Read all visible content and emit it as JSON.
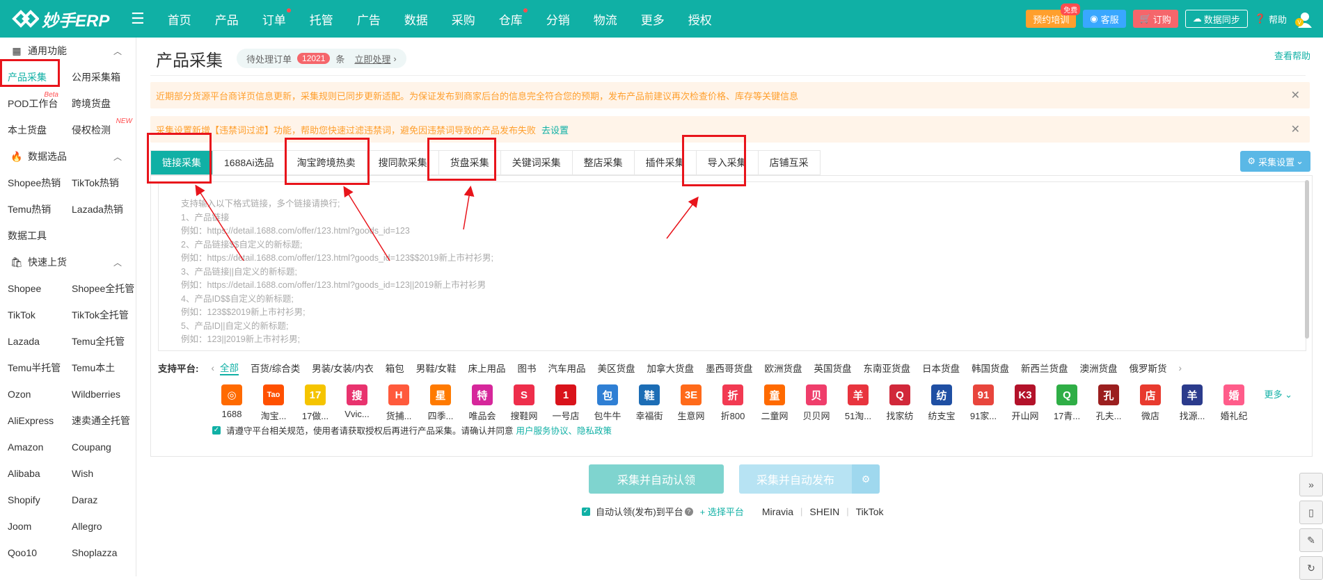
{
  "header": {
    "logo": "妙手ERP",
    "nav": [
      {
        "label": "首页",
        "dot": false
      },
      {
        "label": "产品",
        "dot": false
      },
      {
        "label": "订单",
        "dot": true
      },
      {
        "label": "托管",
        "dot": false
      },
      {
        "label": "广告",
        "dot": false
      },
      {
        "label": "数据",
        "dot": false
      },
      {
        "label": "采购",
        "dot": false
      },
      {
        "label": "仓库",
        "dot": true
      },
      {
        "label": "分销",
        "dot": false
      },
      {
        "label": "物流",
        "dot": false
      },
      {
        "label": "更多",
        "dot": false
      },
      {
        "label": "授权",
        "dot": false
      }
    ],
    "training": "预约培训",
    "free_badge": "免费",
    "service": "客服",
    "order": "订购",
    "sync": "数据同步",
    "help": "帮助"
  },
  "sidebar": {
    "sections": [
      {
        "title": "通用功能",
        "items": [
          {
            "label": "产品采集",
            "active": true,
            "sup": ""
          },
          {
            "label": "公用采集箱",
            "active": false,
            "sup": ""
          },
          {
            "label": "POD工作台",
            "active": false,
            "sup": "Beta"
          },
          {
            "label": "跨境货盘",
            "active": false,
            "sup": ""
          },
          {
            "label": "本土货盘",
            "active": false,
            "sup": ""
          },
          {
            "label": "侵权检测",
            "active": false,
            "sup": "NEW"
          }
        ]
      },
      {
        "title": "数据选品",
        "items": [
          {
            "label": "Shopee热销",
            "active": false,
            "sup": ""
          },
          {
            "label": "TikTok热销",
            "active": false,
            "sup": ""
          },
          {
            "label": "Temu热销",
            "active": false,
            "sup": ""
          },
          {
            "label": "Lazada热销",
            "active": false,
            "sup": ""
          },
          {
            "label": "数据工具",
            "active": false,
            "sup": ""
          }
        ]
      },
      {
        "title": "快速上货",
        "items": [
          {
            "label": "Shopee",
            "active": false,
            "sup": ""
          },
          {
            "label": "Shopee全托管",
            "active": false,
            "sup": ""
          },
          {
            "label": "TikTok",
            "active": false,
            "sup": ""
          },
          {
            "label": "TikTok全托管",
            "active": false,
            "sup": ""
          },
          {
            "label": "Lazada",
            "active": false,
            "sup": ""
          },
          {
            "label": "Temu全托管",
            "active": false,
            "sup": ""
          },
          {
            "label": "Temu半托管",
            "active": false,
            "sup": ""
          },
          {
            "label": "Temu本土",
            "active": false,
            "sup": ""
          },
          {
            "label": "Ozon",
            "active": false,
            "sup": ""
          },
          {
            "label": "Wildberries",
            "active": false,
            "sup": ""
          },
          {
            "label": "AliExpress",
            "active": false,
            "sup": ""
          },
          {
            "label": "速卖通全托管",
            "active": false,
            "sup": ""
          },
          {
            "label": "Amazon",
            "active": false,
            "sup": ""
          },
          {
            "label": "Coupang",
            "active": false,
            "sup": ""
          },
          {
            "label": "Alibaba",
            "active": false,
            "sup": ""
          },
          {
            "label": "Wish",
            "active": false,
            "sup": ""
          },
          {
            "label": "Shopify",
            "active": false,
            "sup": ""
          },
          {
            "label": "Daraz",
            "active": false,
            "sup": ""
          },
          {
            "label": "Joom",
            "active": false,
            "sup": ""
          },
          {
            "label": "Allegro",
            "active": false,
            "sup": ""
          },
          {
            "label": "Qoo10",
            "active": false,
            "sup": ""
          },
          {
            "label": "Shoplazza",
            "active": false,
            "sup": ""
          }
        ]
      }
    ]
  },
  "main": {
    "title": "产品采集",
    "pending_label": "待处理订单",
    "pending_count": "12021",
    "pending_unit": "条",
    "pending_link": "立即处理",
    "help_link": "查看帮助",
    "notice1": "近期部分货源平台商详页信息更新，采集规则已同步更新适配。为保证发布到商家后台的信息完全符合您的预期，发布产品前建议再次检查价格、库存等关键信息",
    "notice2": "采集设置新增【违禁词过滤】功能，帮助您快速过滤违禁词，避免因违禁词导致的产品发布失败",
    "notice2_link": "去设置",
    "tabs": [
      "链接采集",
      "1688Ai选品",
      "淘宝跨境热卖",
      "搜同款采集",
      "货盘采集",
      "关键词采集",
      "整店采集",
      "插件采集",
      "导入采集",
      "店铺互采"
    ],
    "settings_btn": "采集设置",
    "textarea_lines": [
      "支持输入以下格式链接，多个链接请换行;",
      "1、产品链接",
      "例如：https://detail.1688.com/offer/123.html?goods_id=123",
      "2、产品链接$$自定义的新标题;",
      "例如：https://detail.1688.com/offer/123.html?goods_id=123$$2019新上市衬衫男;",
      "3、产品链接||自定义的新标题;",
      "例如：https://detail.1688.com/offer/123.html?goods_id=123||2019新上市衬衫男",
      "4、产品ID$$自定义的新标题;",
      "例如：123$$2019新上市衬衫男;",
      "5、产品ID||自定义的新标题;",
      "例如：123||2019新上市衬衫男;"
    ],
    "platform_label": "支持平台:",
    "categories": [
      "全部",
      "百货/综合类",
      "男装/女装/内衣",
      "箱包",
      "男鞋/女鞋",
      "床上用品",
      "图书",
      "汽车用品",
      "美区货盘",
      "加拿大货盘",
      "墨西哥货盘",
      "欧洲货盘",
      "英国货盘",
      "东南亚货盘",
      "日本货盘",
      "韩国货盘",
      "新西兰货盘",
      "澳洲货盘",
      "俄罗斯货"
    ],
    "platforms": [
      {
        "name": "1688",
        "glyph": "◎",
        "color": "#ff6a00"
      },
      {
        "name": "淘宝...",
        "glyph": "Tao",
        "color": "#ff5000"
      },
      {
        "name": "17做...",
        "glyph": "17",
        "color": "#f5c400"
      },
      {
        "name": "Vvic...",
        "glyph": "搜",
        "color": "#e8336e"
      },
      {
        "name": "货捕...",
        "glyph": "H",
        "color": "#ff5a3c"
      },
      {
        "name": "四季...",
        "glyph": "星",
        "color": "#ff7a00"
      },
      {
        "name": "唯品会",
        "glyph": "特",
        "color": "#d6279b"
      },
      {
        "name": "搜鞋网",
        "glyph": "S",
        "color": "#ee2e4b"
      },
      {
        "name": "一号店",
        "glyph": "1",
        "color": "#d9131b"
      },
      {
        "name": "包牛牛",
        "glyph": "包",
        "color": "#2f7fd4"
      },
      {
        "name": "幸福街",
        "glyph": "鞋",
        "color": "#1c6db5"
      },
      {
        "name": "生意网",
        "glyph": "3E",
        "color": "#ff6a1a"
      },
      {
        "name": "折800",
        "glyph": "折",
        "color": "#f23a52"
      },
      {
        "name": "二童网",
        "glyph": "童",
        "color": "#ff6a00"
      },
      {
        "name": "贝贝网",
        "glyph": "贝",
        "color": "#ef3e6b"
      },
      {
        "name": "51淘...",
        "glyph": "羊",
        "color": "#e8343e"
      },
      {
        "name": "找家纺",
        "glyph": "Q",
        "color": "#d1283a"
      },
      {
        "name": "纺支宝",
        "glyph": "纺",
        "color": "#1f4fa3"
      },
      {
        "name": "91家...",
        "glyph": "91",
        "color": "#e8453c"
      },
      {
        "name": "开山网",
        "glyph": "K3",
        "color": "#b3122a"
      },
      {
        "name": "17青...",
        "glyph": "Q",
        "color": "#2fae46"
      },
      {
        "name": "孔夫...",
        "glyph": "孔",
        "color": "#9b1f1f"
      },
      {
        "name": "微店",
        "glyph": "店",
        "color": "#e83a2e"
      },
      {
        "name": "找源...",
        "glyph": "羊",
        "color": "#2b3b8c"
      },
      {
        "name": "婚礼纪",
        "glyph": "婚",
        "color": "#ff5c8a"
      }
    ],
    "more": "更多",
    "agree_text": "请遵守平台相关规范，使用者请获取授权后再进行产品采集。请确认并同意",
    "agree_link1": "用户服务协议",
    "agree_sep": "、",
    "agree_link2": "隐私政策",
    "btn_collect": "采集并自动认领",
    "btn_publish": "采集并自动发布",
    "auto_label": "自动认领(发布)到平台",
    "select_platform": "+ 选择平台",
    "sites": [
      "Miravia",
      "SHEIN",
      "TikTok"
    ]
  }
}
